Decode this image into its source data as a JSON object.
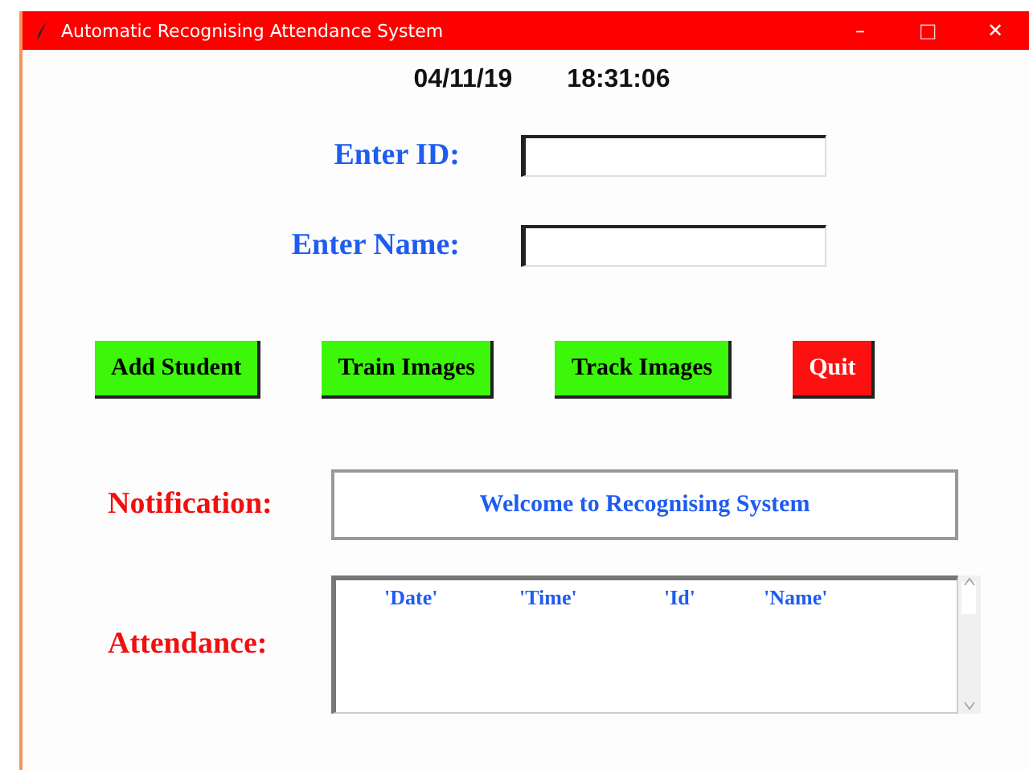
{
  "window": {
    "title": "Automatic Recognising Attendance System",
    "controls": [
      "–",
      "□",
      "✕"
    ]
  },
  "clock": {
    "date": "04/11/19",
    "time": "18:31:06"
  },
  "fields": [
    {
      "label": "Enter ID:"
    },
    {
      "label": "Enter Name:"
    }
  ],
  "buttons": [
    {
      "label": "Add Student",
      "kind": "action"
    },
    {
      "label": "Train Images",
      "kind": "action"
    },
    {
      "label": "Track Images",
      "kind": "action"
    },
    {
      "label": "Quit",
      "kind": "danger"
    }
  ],
  "notification": {
    "label": "Notification:",
    "message": "Welcome to Recognising System"
  },
  "attendance": {
    "label": "Attendance:",
    "columns": [
      "'Date'",
      "'Time'",
      "'Id'",
      "'Name'"
    ]
  }
}
